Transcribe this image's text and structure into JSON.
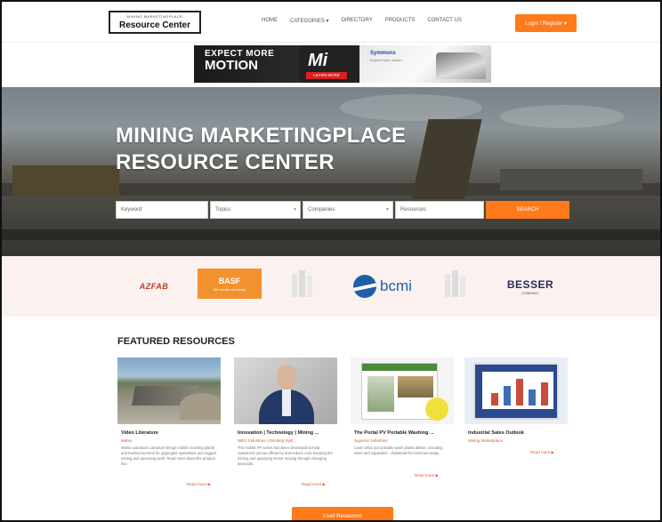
{
  "header": {
    "logo_small": "MINING MARKETINGPLACE",
    "logo_main": "Resource Center",
    "nav": [
      "HOME",
      "CATEGORIES ▾",
      "DIRECTORY",
      "PRODUCTS",
      "CONTACT US"
    ],
    "login_label": "Login / Register ▾"
  },
  "ad": {
    "line1": "EXPECT MORE",
    "line2": "MOTION",
    "mark": "Mi",
    "cta": "LEARN MORE",
    "brand": "Symmons",
    "brand_sub": "Expect more motion"
  },
  "hero": {
    "title_line1": "MINING MARKETINGPLACE",
    "title_line2": "RESOURCE CENTER",
    "search": {
      "keyword_placeholder": "Keyword",
      "topics_label": "Topics",
      "companies_label": "Companies",
      "resources_label": "Resources",
      "button_label": "SEARCH"
    }
  },
  "sponsors": [
    {
      "name": "AZFAB"
    },
    {
      "name": "BASF",
      "sub": "We create chemistry"
    },
    {
      "name": "placeholder-logo-1"
    },
    {
      "name": "bcmi"
    },
    {
      "name": "placeholder-logo-2"
    },
    {
      "name": "BESSER",
      "sub": "COMPANY"
    }
  ],
  "featured": {
    "title": "FEATURED RESOURCES",
    "cards": [
      {
        "title": "Video Literature",
        "author": "Metso",
        "desc": "Metso Lokotrack Literature brings mobile crushing plants and tracked screens for aggregate operations and rugged mining and quarrying work. Read more about the product line.",
        "more": "Read more ▶"
      },
      {
        "title": "Innovation | Technology | Mining ...",
        "author": "WEG Industries | Grinding Syst...",
        "desc": "The mobile PF series has been developed to help customers pursue efficiency and reduce cost, keeping the mining and quarrying sector moving through changing demands.",
        "more": "Read more ▶"
      },
      {
        "title": "The Portal PV Portable Washing ...",
        "author": "Superior Industries",
        "desc": "Learn what our portable wash plants deliver, including sizes and capacities - download the brochure today.",
        "more": "Read more ▶"
      },
      {
        "title": "Industrial Sales Outlook",
        "author": "Mining Marketplace",
        "desc": "",
        "more": "Read more ▶"
      }
    ]
  },
  "load_more_label": "Load Resources",
  "colors": {
    "accent": "#ff7a1a",
    "link": "#e3572b",
    "sponsor_bg": "#fbf1ee"
  }
}
